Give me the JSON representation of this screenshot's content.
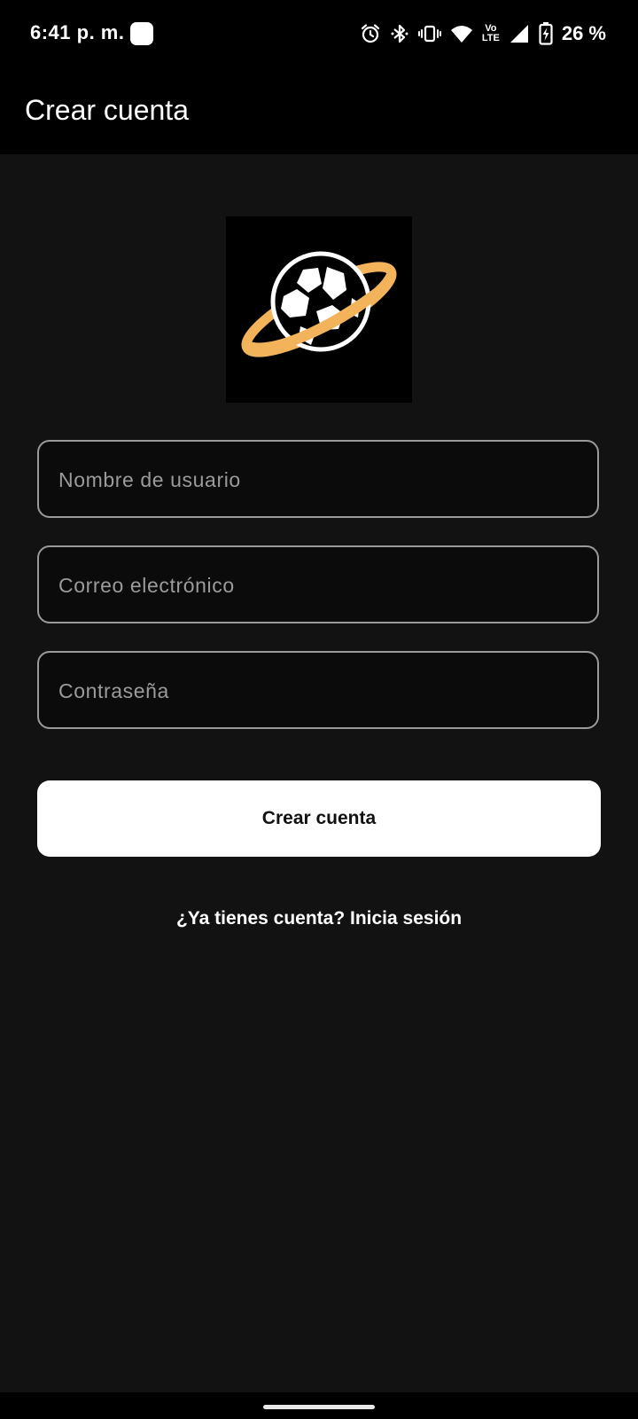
{
  "status_bar": {
    "time": "6:41 p. m.",
    "battery": "26 %",
    "icons": [
      "alarm-icon",
      "bluetooth-icon",
      "vibrate-icon",
      "wifi-icon",
      "volte-icon",
      "signal-icon",
      "battery-charging-icon"
    ],
    "volte_top": "Vo",
    "volte_bottom": "LTE"
  },
  "app_bar": {
    "title": "Crear cuenta"
  },
  "logo": {
    "icon": "soccer-ball-planet-icon",
    "ring_color": "#F2B35B"
  },
  "form": {
    "username_placeholder": "Nombre de usuario",
    "email_placeholder": "Correo electrónico",
    "password_placeholder": "Contraseña",
    "submit_label": "Crear cuenta",
    "login_link": "¿Ya tienes cuenta? Inicia sesión"
  },
  "colors": {
    "background": "#121212",
    "bar": "#000000",
    "field_border": "#9A9A9A",
    "button_bg": "#FFFFFF"
  }
}
